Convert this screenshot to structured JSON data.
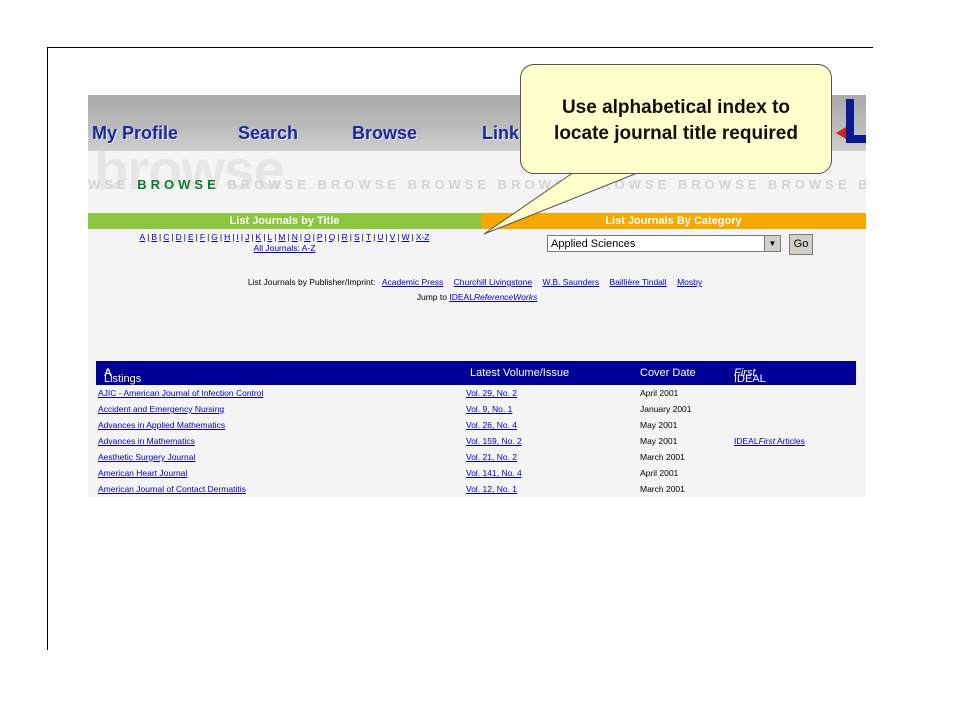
{
  "nav": [
    "My Profile",
    "Search",
    "Browse",
    "Link"
  ],
  "browse_band": {
    "watermark": "browse",
    "strip_lead": "WSE ",
    "strip_highlight": "BROWSE",
    "strip_tail": " BROWSE BROWSE BROWSE BROWSE BROWSE BROWSE BROWSE BROWSE BROW"
  },
  "section_title": "List Journals by Title",
  "section_category": "List Journals By Category",
  "alphabet": [
    "A",
    "B",
    "C",
    "D",
    "E",
    "F",
    "G",
    "H",
    "I",
    "J",
    "K",
    "L",
    "M",
    "N",
    "O",
    "P",
    "Q",
    "R",
    "S",
    "T",
    "U",
    "V",
    "W",
    "X-Z"
  ],
  "all_journals": "All Journals: A-Z",
  "category_select": {
    "value": "Applied Sciences",
    "go": "Go"
  },
  "publisher_line": {
    "label": "List Journals by Publisher/Imprint:",
    "publishers": [
      "Academic Press",
      "Churchill Livingstone",
      "W.B. Saunders",
      "Baillière Tindall",
      "Mosby"
    ]
  },
  "jump": {
    "label": "Jump to",
    "link_prefix": "IDEAL",
    "link_italic": "ReferenceWorks"
  },
  "table": {
    "header_prefix": "Listings for ",
    "header_letter": "A",
    "col_volume": "Latest Volume/Issue",
    "col_date": "Cover Date",
    "col_first_prefix": "IDEAL",
    "col_first_italic": "First",
    "rows": [
      {
        "title": "AJIC - American Journal of Infection Control",
        "volume": "Vol. 29, No. 2",
        "date": "April 2001",
        "first": ""
      },
      {
        "title": "Accident and Emergency Nursing",
        "volume": "Vol. 9, No. 1",
        "date": "January 2001",
        "first": ""
      },
      {
        "title": "Advances in Applied Mathematics",
        "volume": "Vol. 26, No. 4",
        "date": "May 2001",
        "first": ""
      },
      {
        "title": "Advances in Mathematics",
        "volume": "Vol. 159, No. 2",
        "date": "May 2001",
        "first": "IDEALFirst Articles"
      },
      {
        "title": "Aesthetic Surgery Journal",
        "volume": "Vol. 21, No. 2",
        "date": "March 2001",
        "first": ""
      },
      {
        "title": "American Heart Journal",
        "volume": "Vol. 141, No. 4",
        "date": "April 2001",
        "first": ""
      },
      {
        "title": "American Journal of Contact Dermatitis",
        "volume": "Vol. 12, No. 1",
        "date": "March 2001",
        "first": ""
      }
    ]
  },
  "callout": {
    "line1": "Use alphabetical index to",
    "line2": "locate journal title required"
  },
  "colors": {
    "nav_text": "#1a2a9a",
    "title_bar": "#8cc63f",
    "category_bar": "#f5a800",
    "table_header": "#000099",
    "link": "#0000cc",
    "callout_fill": "#ffffcc",
    "browse_highlight": "#0a7d2c"
  }
}
